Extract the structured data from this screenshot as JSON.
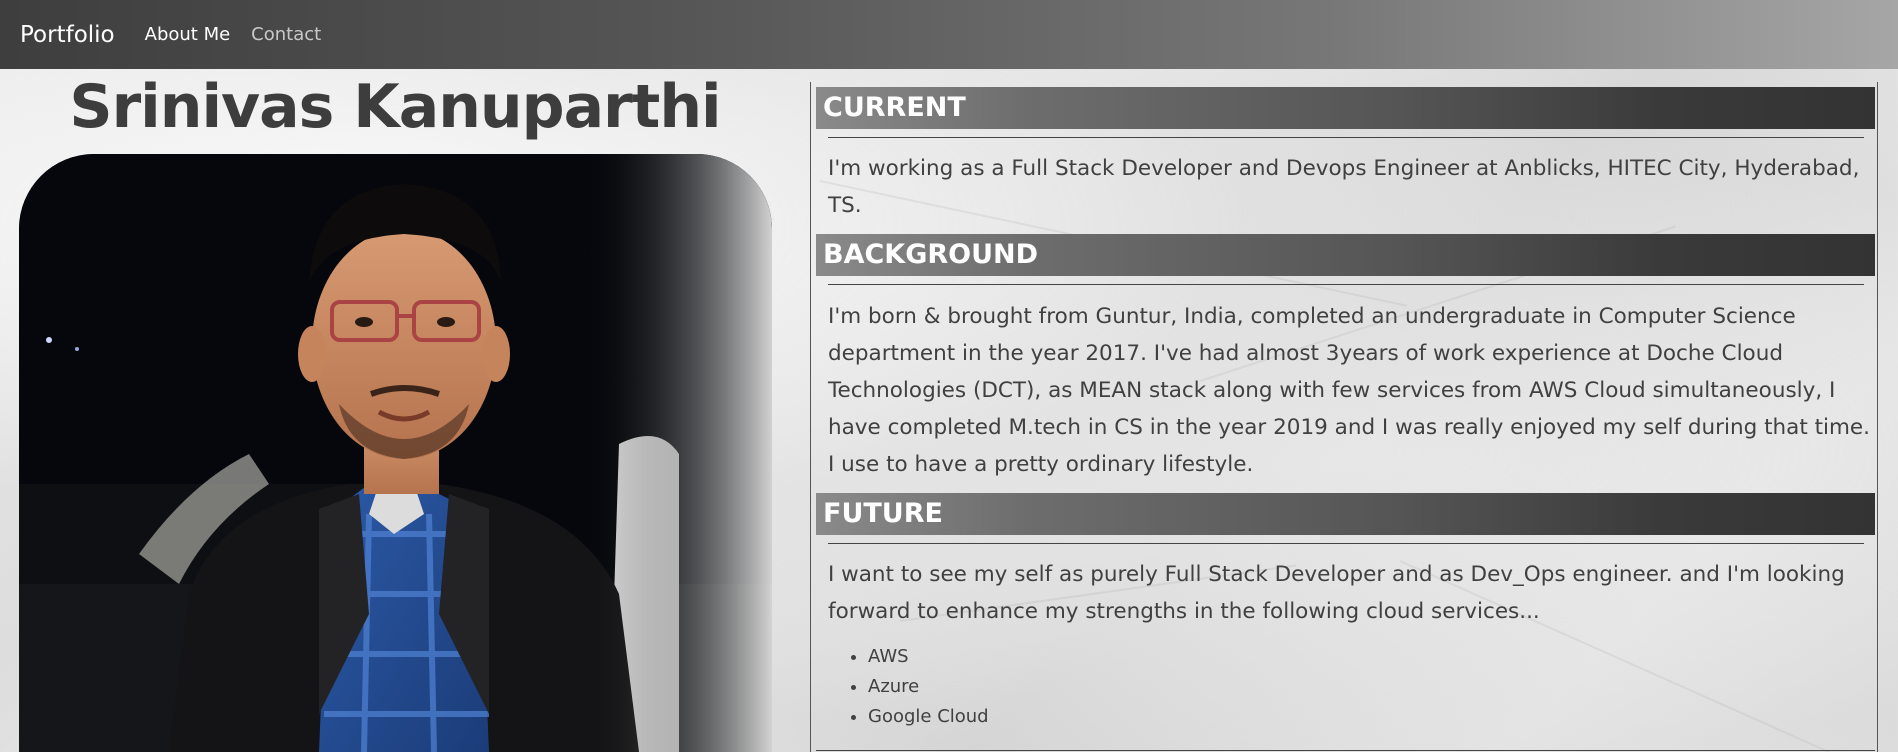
{
  "navbar": {
    "brand": "Portfolio",
    "links": [
      "About Me",
      "Contact"
    ]
  },
  "profile": {
    "name": "Srinivas Kanuparthi",
    "photo_alt": "profile-photo"
  },
  "sections": [
    {
      "heading": "CURRENT",
      "text": "I'm working as a Full Stack Developer and Devops Engineer at Anblicks, HITEC City, Hyderabad, TS."
    },
    {
      "heading": "BACKGROUND",
      "text": "I'm born & brought from Guntur, India, completed an undergraduate in Computer Science department in the year 2017. I've had almost 3years of work experience at Doche Cloud Technologies (DCT), as MEAN stack along with few services from AWS Cloud simultaneously, I have completed M.tech in CS in the year 2019 and I was really enjoyed my self during that time. I use to have a pretty ordinary lifestyle."
    },
    {
      "heading": "FUTURE",
      "text": "I want to see my self as purely Full Stack Developer and as Dev_Ops engineer. and I'm looking forward to enhance my strengths in the following cloud services..."
    }
  ],
  "cloud_services": [
    "AWS",
    "Azure",
    "Google Cloud"
  ],
  "colors": {
    "navbar_start": "#3e3e3e",
    "navbar_end": "#a6a6a6",
    "heading_text": "#3d3d3d",
    "body_text": "#404040"
  }
}
